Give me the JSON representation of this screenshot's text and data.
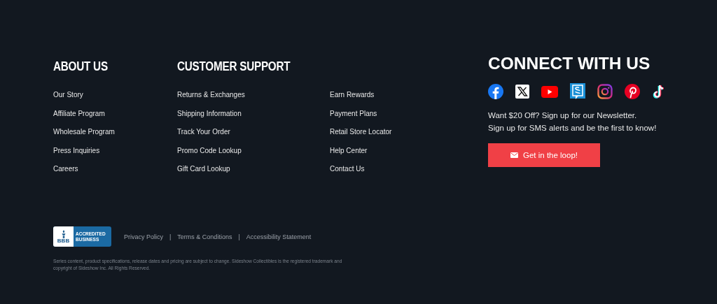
{
  "about": {
    "heading": "ABOUT US",
    "links": [
      "Our Story",
      "Affiliate Program",
      "Wholesale Program",
      "Press Inquiries",
      "Careers"
    ]
  },
  "support": {
    "heading": "CUSTOMER SUPPORT",
    "columns": [
      [
        "Returns & Exchanges",
        "Shipping Information",
        "Track Your Order",
        "Promo Code Lookup",
        "Gift Card Lookup"
      ],
      [
        "Earn Rewards",
        "Payment Plans",
        "Retail Store Locator",
        "Help Center",
        "Contact Us"
      ]
    ]
  },
  "connect": {
    "heading": "CONNECT WITH US",
    "text_lines": [
      "Want $20 Off? Sign up for our Newsletter.",
      "Sign up for SMS alerts and be the first to know!"
    ],
    "button": "Get in the loop!"
  },
  "badge": {
    "logo_text": "BBB",
    "lines": [
      "ACCREDITED",
      "BUSINESS"
    ]
  },
  "legal_links": [
    "Privacy Policy",
    "Terms & Conditions",
    "Accessibility Statement"
  ],
  "separator": "|",
  "disclaimer": "Series content, product specifications, release dates and pricing are subject to change. Sideshow Collectibles is the registered trademark and copyright of Sideshow Inc. All Rights Reserved."
}
